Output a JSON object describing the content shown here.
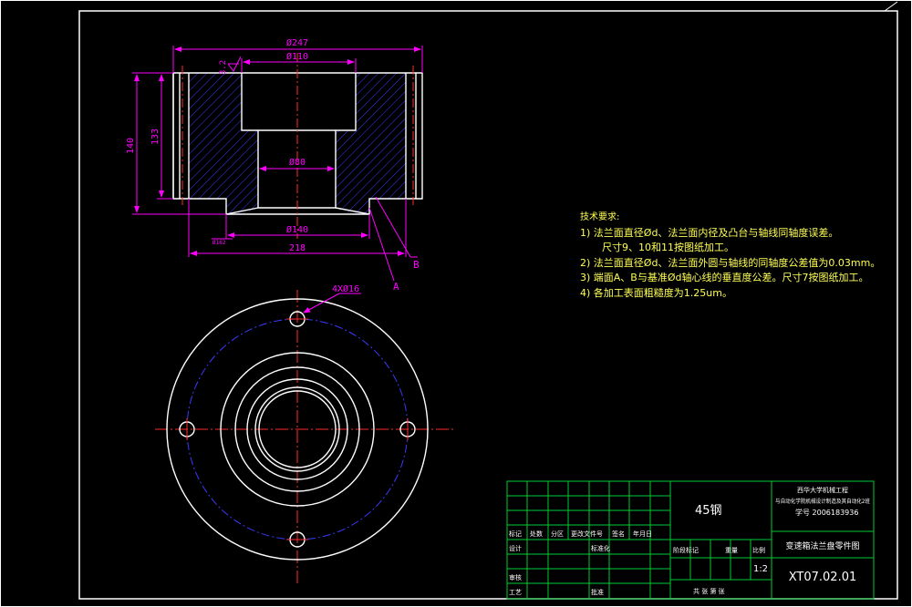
{
  "dims": {
    "d247": "Ø247",
    "d110": "Ø110",
    "d80": "Ø80",
    "d140": "Ø140",
    "len218": "218",
    "h140": "140",
    "h133": "133",
    "holes": "4XØ16",
    "rough": "3.2",
    "small": "Ø162",
    "labelA": "A",
    "labelB": "B"
  },
  "notes": {
    "header": "技术要求:",
    "items": [
      "1) 法兰面直径Ød、法兰面内径及凸台与轴线同轴度误差。",
      "    尺寸9、10和11按图纸加工。",
      "2) 法兰面直径Ød、法兰面外圆与轴线的同轴度公差值为0.03mm。",
      "3) 端面A、B与基准Ød轴心线的垂直度公差。尺寸7按图纸加工。",
      "4) 各加工表面粗糙度为1.25um。"
    ]
  },
  "title_block": {
    "material": "45钢",
    "school_1": "西华大学机械工程",
    "school_2": "与自动化学院机械设计制造及其自动化2班",
    "student": "学号 2006183936",
    "part_name": "变速箱法兰盘零件图",
    "drawing_no": "XT07.02.01",
    "scale": "1:2",
    "row_labels": [
      "标记",
      "处数",
      "分区",
      "更改文件号",
      "签名",
      "年月日"
    ],
    "design": "设计",
    "standard": "标准化",
    "review": "审核",
    "process": "工艺",
    "approve": "批准",
    "stage": "阶段标记",
    "weight": "重量",
    "ratio": "比例",
    "sheets": "共  张  第  张"
  },
  "colors": {
    "background": "#000000",
    "outline": "#ffffff",
    "dimension": "#ff00ff",
    "hatch": "#3a3aff",
    "center": "#ff2a2a",
    "pitch_circle": "#3a3aff",
    "table": "#00cc33",
    "note": "#ffff55"
  }
}
